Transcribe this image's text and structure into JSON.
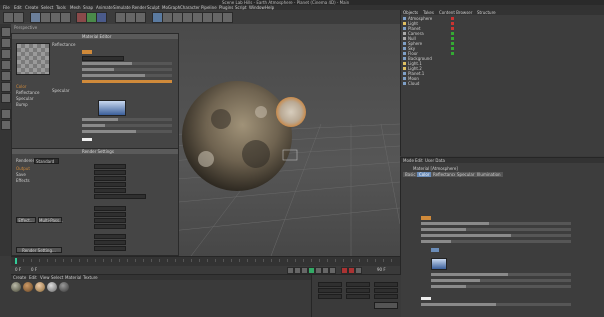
{
  "window": {
    "title": "Scene Lab Hills - Earth Atmosphere - Planet (Cinema 4D) - Main"
  },
  "main_menu": {
    "items": [
      "File",
      "Edit",
      "Create",
      "Select",
      "Tools",
      "Mesh",
      "Snap",
      "Animate",
      "Simulate",
      "Render",
      "Sculpt",
      "MoGraph",
      "Character",
      "Pipeline",
      "Plugins",
      "Script",
      "Window",
      "Help"
    ]
  },
  "material_editor": {
    "title": "Material Editor",
    "channels": [
      "Color",
      "Reflectance",
      "Specular",
      "Bump"
    ],
    "sections": [
      "Reflectance",
      "Specular"
    ],
    "buttons": {
      "on": "On"
    }
  },
  "render_settings": {
    "title": "Render Settings",
    "renderer_label": "Renderer",
    "renderer_value": "Standard",
    "nav": [
      "Output",
      "Save",
      "Effects"
    ],
    "buttons": {
      "effect": "Effect...",
      "multi_pass": "Multi-Pass...",
      "render_setting": "Render Setting..."
    }
  },
  "viewport": {
    "label": "Perspective"
  },
  "object_manager": {
    "tabs": [
      "Objects",
      "Takes",
      "Content Browser",
      "Structure"
    ],
    "items": [
      "Atmosphere",
      "Light",
      "Planet",
      "Camera",
      "Null",
      "Sphere",
      "Sky",
      "Floor",
      "Background",
      "Light.1",
      "Light.2",
      "Planet.1",
      "Moon",
      "Cloud"
    ]
  },
  "attribute_manager": {
    "tabs": [
      "Mode",
      "Edit",
      "User Data"
    ],
    "title": "Material [Atmosphere]",
    "subtabs": [
      "Basic",
      "Color",
      "Reflectance",
      "Specular",
      "Illumination"
    ]
  },
  "timeline": {
    "frame_start": "0 F",
    "frame_end": "90 F",
    "current": "0 F"
  },
  "material_manager": {
    "tabs": [
      "Create",
      "Edit",
      "View",
      "Select",
      "Material",
      "Texture"
    ]
  }
}
